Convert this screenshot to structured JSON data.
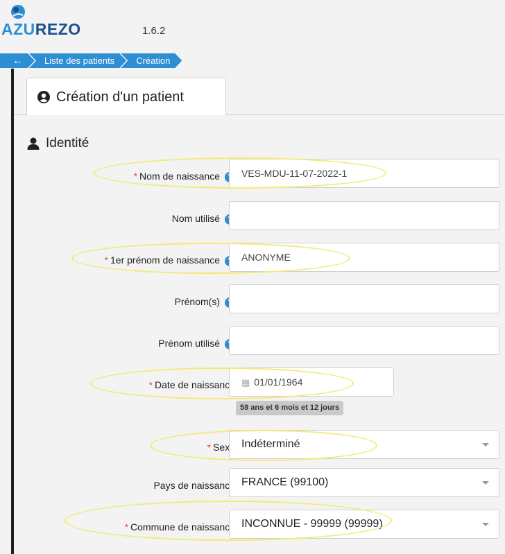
{
  "header": {
    "logo": {
      "prefix": "AZU",
      "suffix": "REZO"
    },
    "version": "1.6.2"
  },
  "breadcrumb": {
    "items": [
      "Liste des patients",
      "Création"
    ]
  },
  "tab": {
    "title": "Création d'un patient"
  },
  "section": {
    "title": "Identité"
  },
  "form": {
    "nom_naissance": {
      "label": "Nom de naissance",
      "value": "VES-MDU-11-07-2022-1"
    },
    "nom_utilise": {
      "label": "Nom utilisé",
      "value": ""
    },
    "premier_prenom": {
      "label": "1er prénom de naissance",
      "value": "ANONYME"
    },
    "prenoms": {
      "label": "Prénom(s)",
      "value": ""
    },
    "prenom_utilise": {
      "label": "Prénom utilisé",
      "value": ""
    },
    "date_naissance": {
      "label": "Date de naissance",
      "value": "01/01/1964",
      "age": "58 ans et 6 mois et 12 jours"
    },
    "sexe": {
      "label": "Sexe",
      "value": "Indéterminé"
    },
    "pays_naissance": {
      "label": "Pays de naissance",
      "value": "FRANCE (99100)"
    },
    "commune_naissance": {
      "label": "Commune de naissance",
      "value": "INCONNUE - 99999 (99999)"
    }
  },
  "colors": {
    "accent": "#2d8ed3",
    "required": "#d9534f",
    "highlight": "#f2ea76"
  }
}
